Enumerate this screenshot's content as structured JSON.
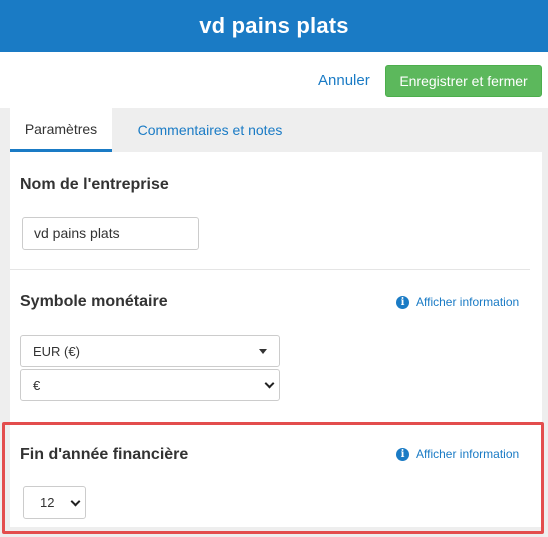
{
  "header": {
    "title": "vd pains plats"
  },
  "actions": {
    "cancel_label": "Annuler",
    "save_label": "Enregistrer et fermer"
  },
  "tabs": [
    {
      "label": "Paramètres",
      "active": true
    },
    {
      "label": "Commentaires et notes",
      "active": false
    }
  ],
  "company": {
    "title": "Nom de l'entreprise",
    "value": "vd pains plats"
  },
  "currency": {
    "title": "Symbole monétaire",
    "info_label": "Afficher information",
    "selected_currency": "EUR (€)",
    "selected_symbol": "€"
  },
  "fiscal_year": {
    "title": "Fin d'année financière",
    "info_label": "Afficher information",
    "selected_month": "12"
  },
  "colors": {
    "brand_blue": "#1a7bc5",
    "save_green": "#5cb85c",
    "highlight_red": "#e34d4d"
  },
  "icons": {
    "info": "info-circle-icon",
    "dropdown": "chevron-down-icon"
  }
}
